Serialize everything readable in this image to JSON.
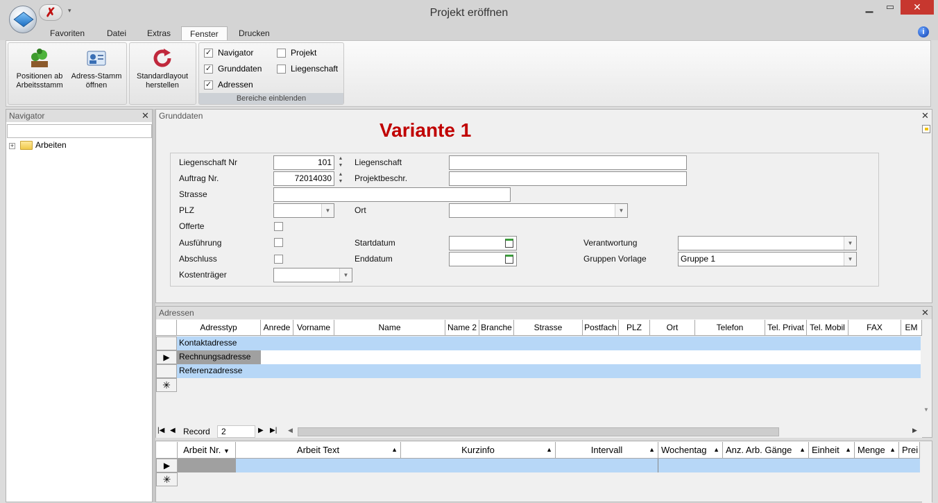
{
  "window": {
    "title": "Projekt eröffnen"
  },
  "ribbon": {
    "tabs": [
      "Favoriten",
      "Datei",
      "Extras",
      "Fenster",
      "Drucken"
    ],
    "active_tab": "Fenster",
    "buttons": {
      "positionen": "Positionen ab Arbeitsstamm",
      "adress": "Adress-Stamm öffnen",
      "standard": "Standardlayout herstellen"
    },
    "checkboxes": [
      {
        "label": "Navigator",
        "checked": true
      },
      {
        "label": "Grunddaten",
        "checked": true
      },
      {
        "label": "Adressen",
        "checked": true
      },
      {
        "label": "Projekt",
        "checked": false
      },
      {
        "label": "Liegenschaft",
        "checked": false
      }
    ],
    "group_label": "Bereiche einblenden"
  },
  "navigator": {
    "title": "Navigator",
    "tree_root": "Arbeiten"
  },
  "grunddaten": {
    "title": "Grunddaten",
    "heading": "Variante 1",
    "labels": {
      "liegenschaft_nr": "Liegenschaft Nr",
      "auftrag_nr": "Auftrag Nr.",
      "strasse": "Strasse",
      "plz": "PLZ",
      "offerte": "Offerte",
      "ausfuehrung": "Ausführung",
      "abschluss": "Abschluss",
      "kostentraeger": "Kostenträger",
      "liegenschaft": "Liegenschaft",
      "projektbeschr": "Projektbeschr.",
      "ort": "Ort",
      "startdatum": "Startdatum",
      "enddatum": "Enddatum",
      "verantwortung": "Verantwortung",
      "gruppen_vorlage": "Gruppen Vorlage"
    },
    "values": {
      "liegenschaft_nr": "101",
      "auftrag_nr": "72014030",
      "gruppen_vorlage": "Gruppe 1"
    }
  },
  "adressen": {
    "title": "Adressen",
    "columns": [
      "Adresstyp",
      "Anrede",
      "Vorname",
      "Name",
      "Name 2",
      "Branche",
      "Strasse",
      "Postfach",
      "PLZ",
      "Ort",
      "Telefon",
      "Tel. Privat",
      "Tel. Mobil",
      "FAX",
      "EM"
    ],
    "rows": [
      "Kontaktadresse",
      "Rechnungsadresse",
      "Referenzadresse"
    ],
    "current_row": 2,
    "record_label": "Record",
    "record_value": "2"
  },
  "arbeiten": {
    "columns": [
      "Arbeit Nr.",
      "Arbeit Text",
      "Kurzinfo",
      "Intervall",
      "Wochentag",
      "Anz. Arb. Gänge",
      "Einheit",
      "Menge",
      "Prei"
    ]
  },
  "colors": {
    "accent": "#c00000",
    "row_highlight": "#b7d7f7",
    "close_red": "#c7372f"
  }
}
